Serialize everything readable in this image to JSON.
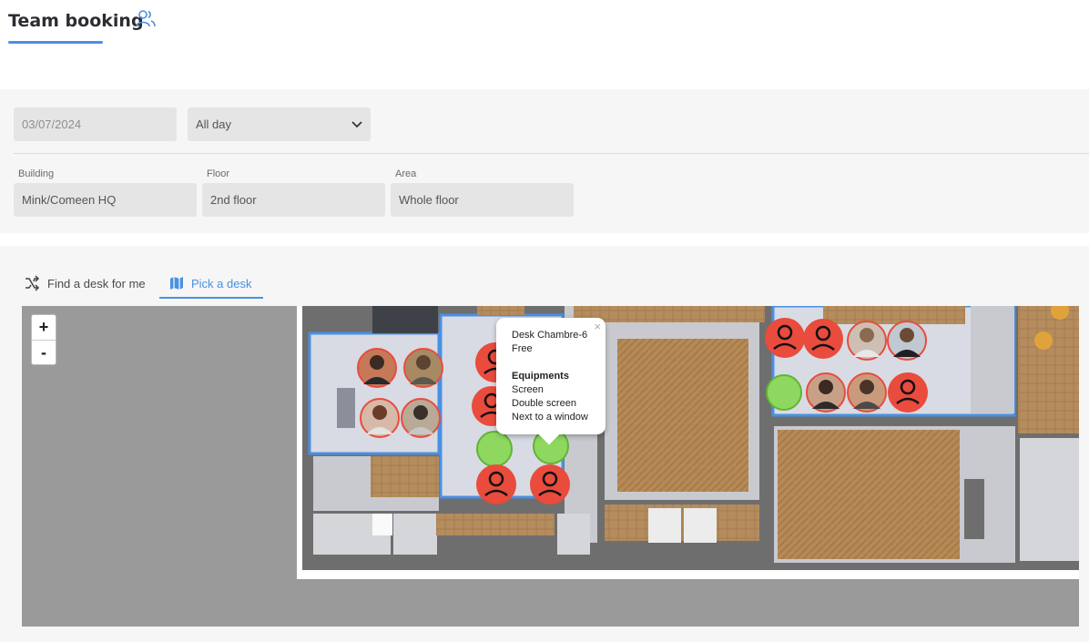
{
  "header": {
    "title": "Team booking",
    "icon": "users-icon"
  },
  "filters": {
    "date": "03/07/2024",
    "time": "All day",
    "building": {
      "label": "Building",
      "value": "Mink/Comeen HQ"
    },
    "floor": {
      "label": "Floor",
      "value": "2nd floor"
    },
    "area": {
      "label": "Area",
      "value": "Whole floor"
    }
  },
  "tabs": [
    {
      "label": "Find a desk for me",
      "icon": "shuffle-icon",
      "active": false
    },
    {
      "label": "Pick a desk",
      "icon": "map-icon",
      "active": true
    }
  ],
  "map": {
    "zoom_in": "+",
    "zoom_out": "-",
    "popup": {
      "desk": "Desk Chambre-6",
      "status": "Free",
      "equipments_title": "Equipments",
      "equipments": [
        "Screen",
        "Double screen",
        "Next to a window"
      ]
    },
    "colors": {
      "free": "#8ed860",
      "occupied": "#e94b3c",
      "room_border": "#4a90e2",
      "wood": "#b68a57"
    }
  }
}
